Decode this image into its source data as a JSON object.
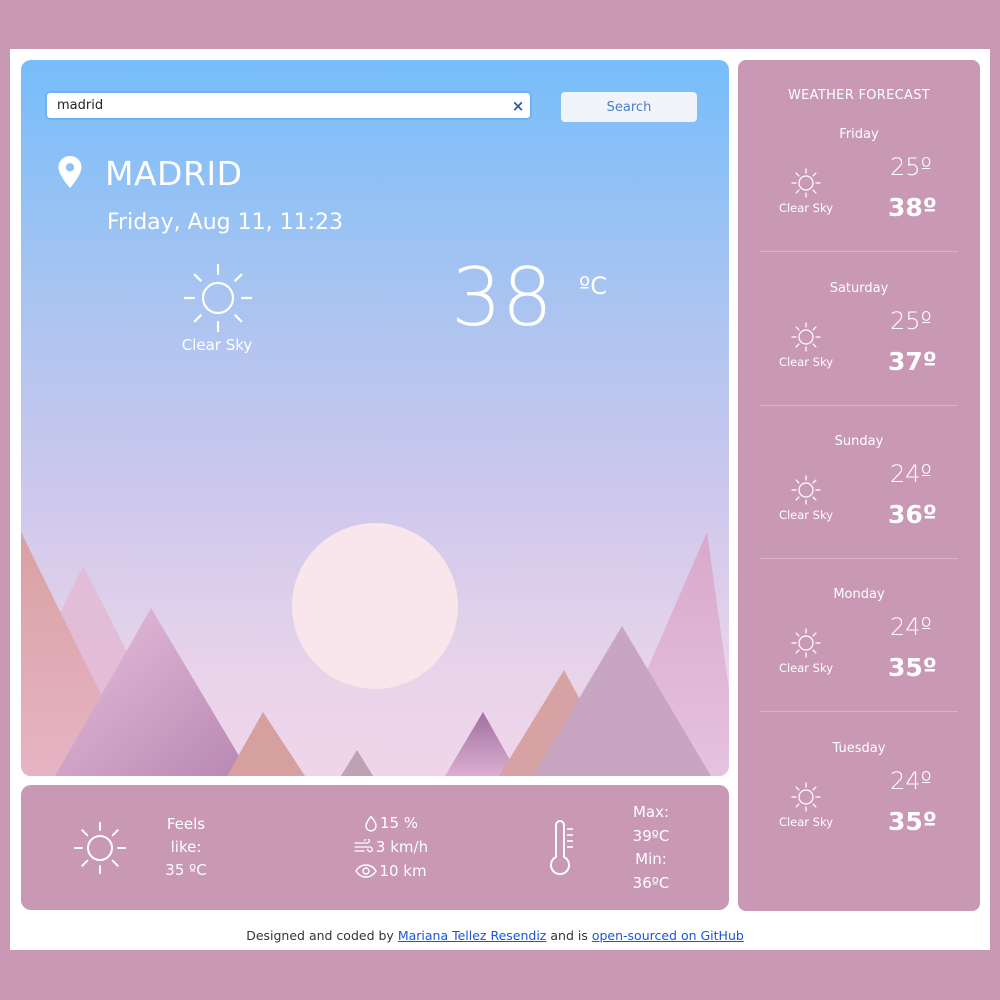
{
  "search": {
    "value": "madrid",
    "button_label": "Search",
    "clear_icon": "close-icon"
  },
  "current": {
    "city": "MADRID",
    "datetime": "Friday, Aug 11, 11:23",
    "description": "Clear Sky",
    "temperature": "38",
    "unit": "ºC",
    "icon": "sun-icon"
  },
  "details": {
    "feels_like_label_1": "Feels",
    "feels_like_label_2": "like:",
    "feels_like_value": "35 ºC",
    "humidity": "15 %",
    "wind": "3 km/h",
    "visibility": "10 km",
    "max_label": "Max:",
    "max_value": "39ºC",
    "min_label": "Min:",
    "min_value": "36ºC"
  },
  "forecast": {
    "title": "WEATHER FORECAST",
    "days": [
      {
        "day": "Friday",
        "description": "Clear Sky",
        "min": "25º",
        "max": "38º"
      },
      {
        "day": "Saturday",
        "description": "Clear Sky",
        "min": "25º",
        "max": "37º"
      },
      {
        "day": "Sunday",
        "description": "Clear Sky",
        "min": "24º",
        "max": "36º"
      },
      {
        "day": "Monday",
        "description": "Clear Sky",
        "min": "24º",
        "max": "35º"
      },
      {
        "day": "Tuesday",
        "description": "Clear Sky",
        "min": "24º",
        "max": "35º"
      }
    ]
  },
  "footer": {
    "prefix": "Designed and coded by",
    "author_link": "Mariana Tellez Resendiz",
    "middle": "and is",
    "source_link": "open-sourced on GitHub"
  },
  "colors": {
    "page_background": "#c898b4",
    "panel": "#c898b4",
    "sky_top": "#76bdfb",
    "link": "#1a55d8"
  }
}
